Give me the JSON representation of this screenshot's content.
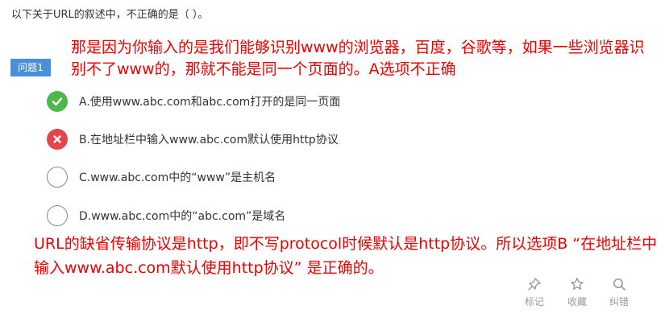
{
  "question": {
    "stem": "以下关于URL的叙述中，不正确的是（ ）。",
    "badge": "问题1"
  },
  "annotation_top": "那是因为你输入的是我们能够识别www的浏览器，百度，谷歌等，如果一些浏览器识别不了www的，那就不能是同一个页面的。A选项不正确",
  "options": [
    {
      "text": "A.使用www.abc.com和abc.com打开的是同一页面",
      "state": "correct",
      "icon": "check-icon"
    },
    {
      "text": "B.在地址栏中输入www.abc.com默认使用http协议",
      "state": "wrong",
      "icon": "cross-icon"
    },
    {
      "text": "C.www.abc.com中的“www”是主机名",
      "state": "unselected",
      "icon": ""
    },
    {
      "text": "D.www.abc.com中的“abc.com”是域名",
      "state": "unselected",
      "icon": ""
    }
  ],
  "annotation_bottom": "URL的缺省传输协议是http，即不写protocol时候默认是http协议。所以选项B “在地址栏中输入www.abc.com默认使用http协议” 是正确的。",
  "tools": [
    {
      "label": "标记",
      "icon": "pin-icon"
    },
    {
      "label": "收藏",
      "icon": "star-icon"
    },
    {
      "label": "纠错",
      "icon": "magnifier-icon"
    }
  ],
  "colors": {
    "accent": "#4a90d9",
    "correct": "#4cb84c",
    "wrong": "#e8434b",
    "annotation": "#ee0000",
    "muted": "#999999"
  }
}
